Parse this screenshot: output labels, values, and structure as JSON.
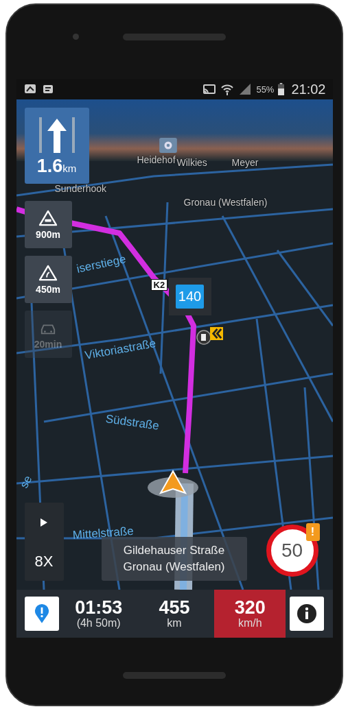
{
  "status_bar": {
    "battery": "55%",
    "time": "21:02"
  },
  "maneuver": {
    "distance": "1.6",
    "unit": "km"
  },
  "alerts": [
    {
      "kind": "slippery",
      "distance": "900m",
      "disabled": false
    },
    {
      "kind": "curve",
      "distance": "450m",
      "disabled": false
    },
    {
      "kind": "traffic",
      "distance": "20min",
      "disabled": true
    }
  ],
  "map_labels": [
    "Heidehof",
    "Wilkies",
    "Meyer",
    "Sunderhook",
    "Gronau (Westfalen)",
    "iserstiege",
    "Viktoriastraße",
    "Südstraße",
    "se",
    "Mittelstraße"
  ],
  "road_badge": "K2",
  "speed_camera_limit": "140",
  "playback": {
    "speed": "8X"
  },
  "current_street": {
    "street": "Gildehauser Straße",
    "city": "Gronau (Westfalen)"
  },
  "speed_limit": {
    "value": "50",
    "warning": "!"
  },
  "trip": {
    "time": "01:53",
    "duration": "(4h 50m)",
    "distance": "455",
    "distance_unit": "km",
    "speed": "320",
    "speed_unit": "km/h",
    "speeding": true
  }
}
